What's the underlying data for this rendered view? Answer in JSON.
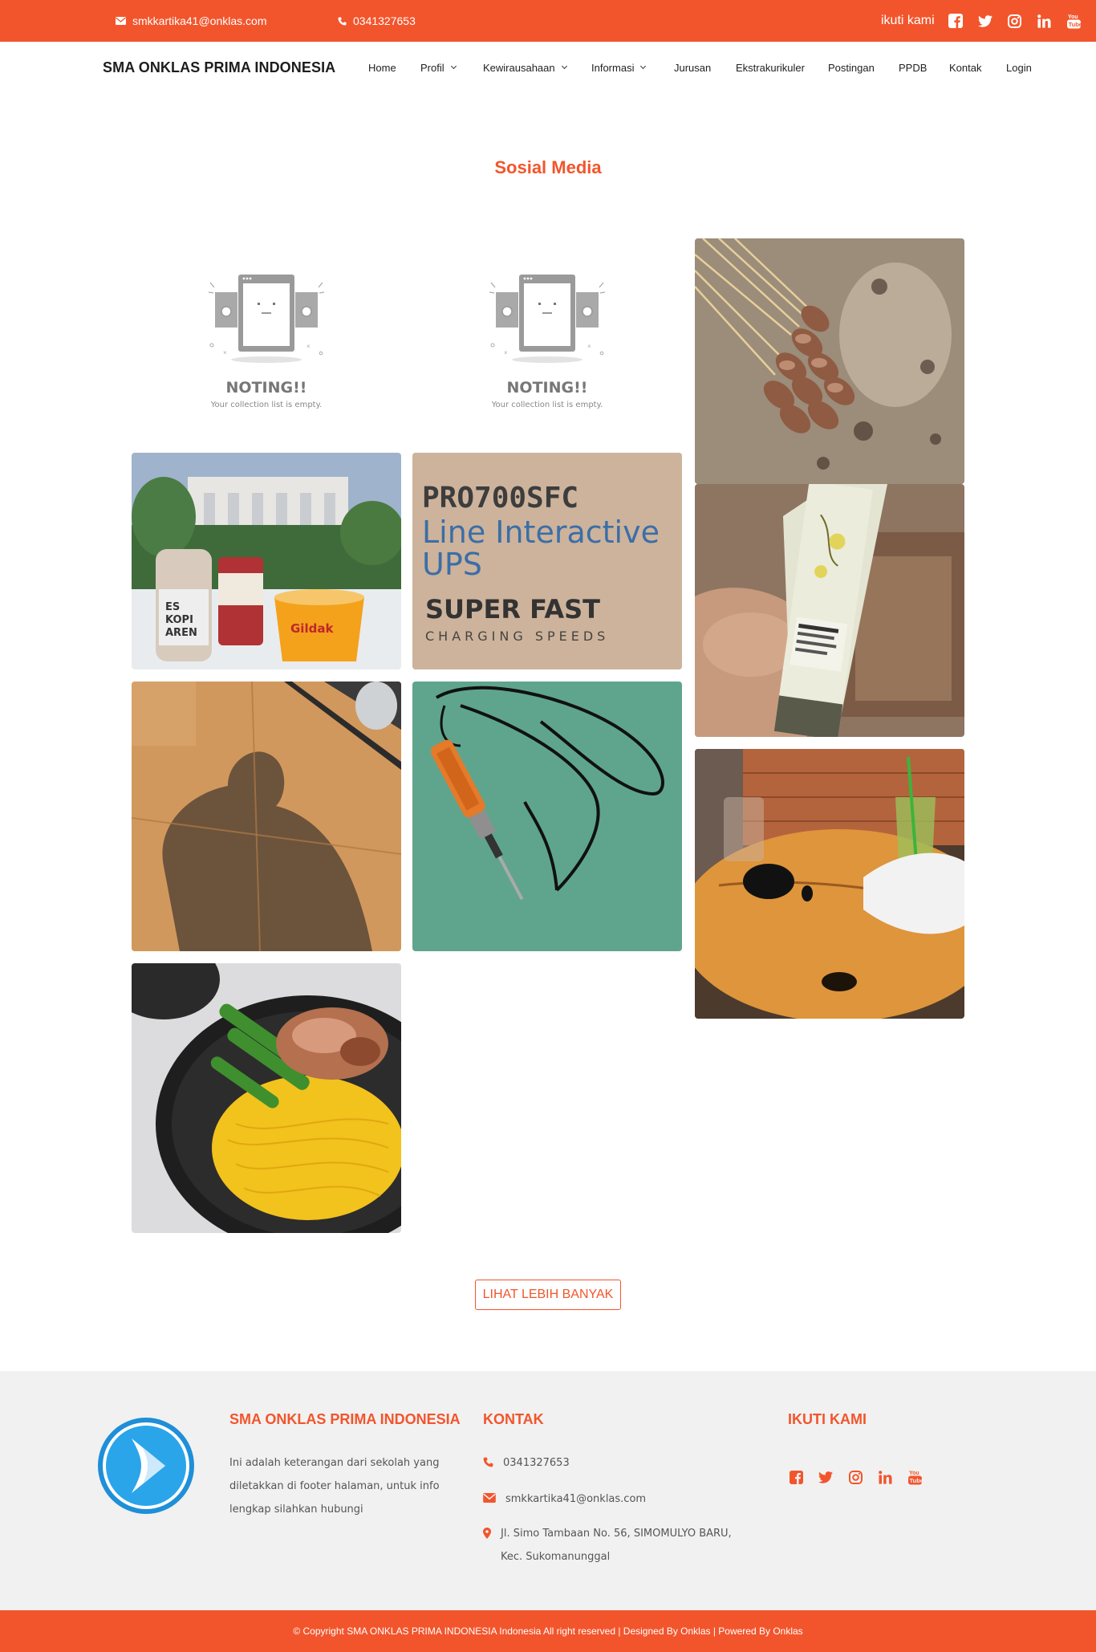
{
  "topbar": {
    "email": "smkkartika41@onklas.com",
    "phone": "0341327653",
    "follow_label": "ikuti kami",
    "socials": [
      "facebook-icon",
      "twitter-icon",
      "instagram-icon",
      "linkedin-icon",
      "youtube-icon"
    ],
    "bg_color": "#f2552c"
  },
  "nav": {
    "brand": "SMA ONKLAS PRIMA INDONESIA",
    "items": [
      {
        "label": "Home",
        "dropdown": false
      },
      {
        "label": "Profil",
        "dropdown": true
      },
      {
        "label": "Kewirausahaan",
        "dropdown": true
      },
      {
        "label": "Informasi",
        "dropdown": true
      },
      {
        "label": "Jurusan",
        "dropdown": false
      },
      {
        "label": "Ekstrakurikuler",
        "dropdown": false
      },
      {
        "label": "Postingan",
        "dropdown": false
      },
      {
        "label": "PPDB",
        "dropdown": false
      },
      {
        "label": "Kontak",
        "dropdown": false
      },
      {
        "label": "Login",
        "dropdown": false
      }
    ]
  },
  "section": {
    "title": "Sosial Media"
  },
  "gallery": {
    "empty_title": "NOTING!!",
    "empty_subtitle": "Your collection list is empty.",
    "ups_photo": {
      "line1": "PRO700SFC",
      "line2": "Line Interactive",
      "line3": "UPS",
      "line4": "SUPER FAST",
      "line5": "CHARGING SPEEDS"
    },
    "drink_photo": {
      "bottle_label_1": "ES",
      "bottle_label_2": "KOPI",
      "bottle_label_3": "AREN",
      "cup_label": "Gildak"
    }
  },
  "more_button": "LIHAT LEBIH BANYAK",
  "footer": {
    "about_title": "SMA ONKLAS PRIMA INDONESIA",
    "about_text": "Ini adalah keterangan dari sekolah yang diletakkan di footer halaman, untuk info lengkap silahkan hubungi",
    "contact_title": "KONTAK",
    "phone": "0341327653",
    "email": "smkkartika41@onklas.com",
    "address": "Jl. Simo Tambaan No. 56, SIMOMULYO BARU, Kec. Sukomanunggal",
    "follow_title": "IKUTI KAMI",
    "accent_color": "#f2552c"
  },
  "copyright": "© Copyright SMA ONKLAS PRIMA INDONESIA Indonesia All right reserved | Designed By Onklas | Powered By Onklas"
}
